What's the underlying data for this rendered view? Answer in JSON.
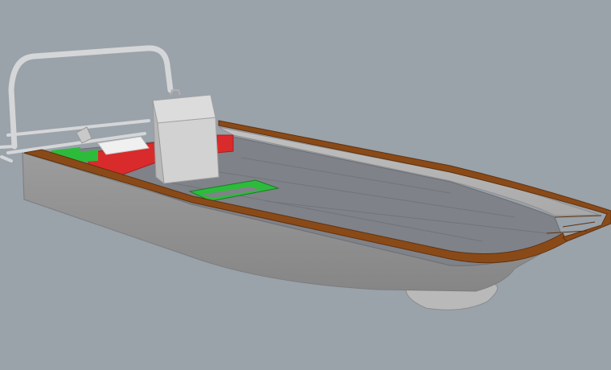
{
  "viewport": {
    "background": "#9aa2aa"
  },
  "model": {
    "subject": "boat-hull",
    "colors": {
      "hull": "#9c9c9c",
      "hull_shadow": "#868686",
      "inner_wall": "#b4b4b4",
      "deck": "#7f8288",
      "gunwale": "#8a4a18",
      "rail": "#d4d6d8",
      "console": "#d2d2d2",
      "red_panel": "#d92b2b",
      "green_panel": "#2dbb3b",
      "white_panel": "#f0f0f0"
    }
  }
}
